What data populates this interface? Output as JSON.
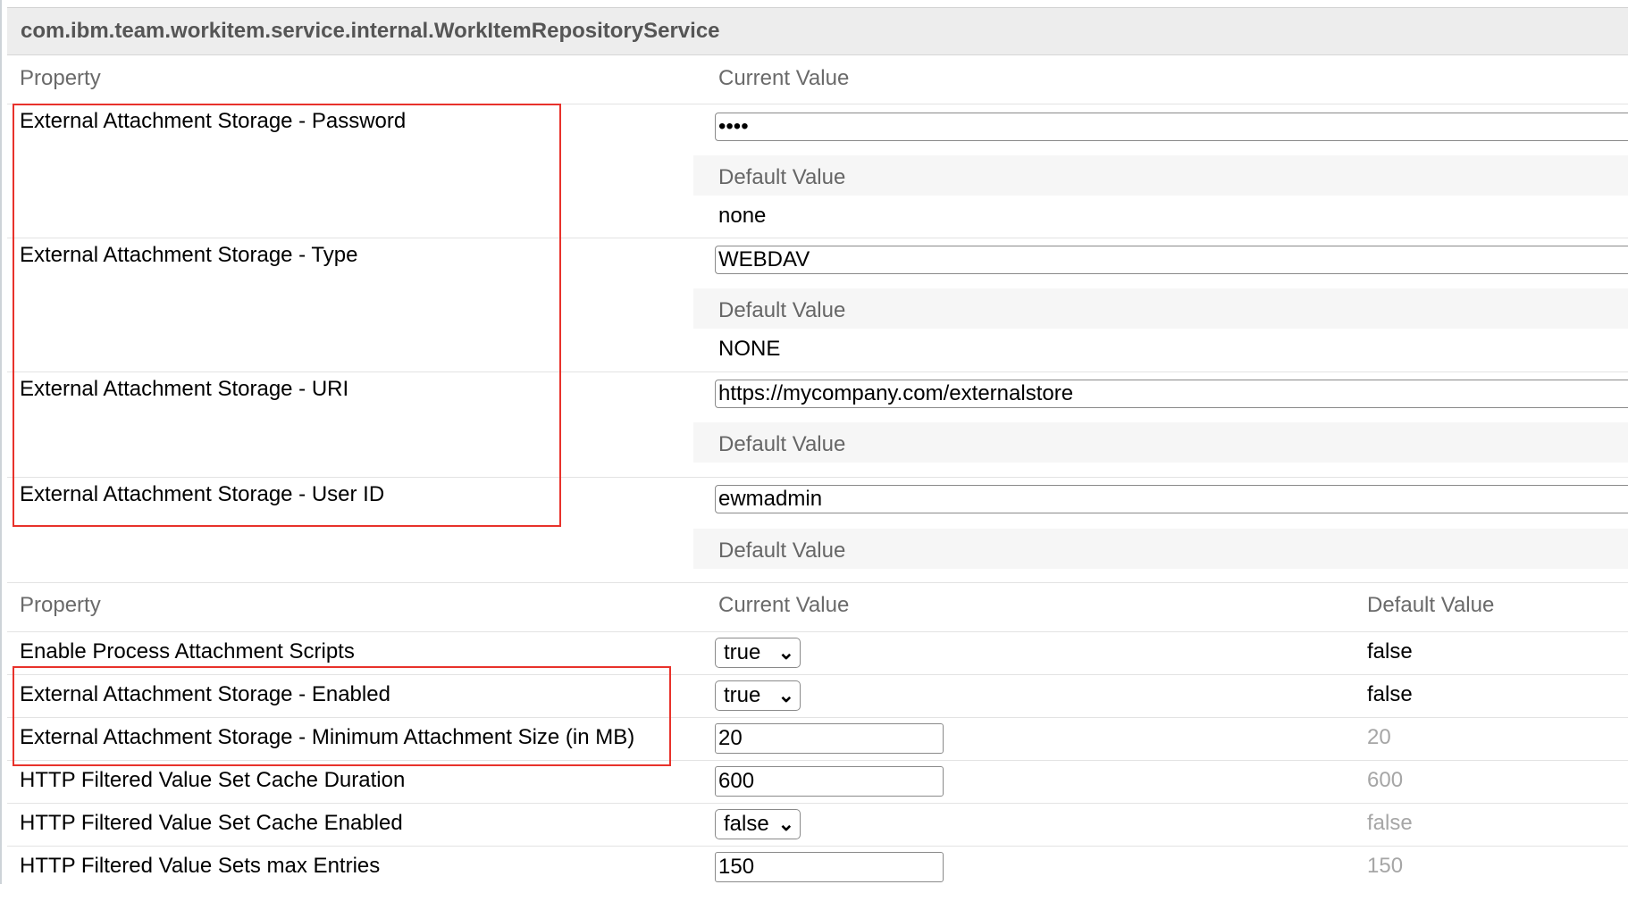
{
  "service": {
    "title": "com.ibm.team.workitem.service.internal.WorkItemRepositoryService"
  },
  "section1": {
    "columns": {
      "property": "Property",
      "current_value": "Current Value"
    },
    "default_label": "Default Value",
    "rows": [
      {
        "property": "External Attachment Storage - Password",
        "current": "••••",
        "default": "none"
      },
      {
        "property": "External Attachment Storage - Type",
        "current": "WEBDAV",
        "default": "NONE"
      },
      {
        "property": "External Attachment Storage - URI",
        "current": "https://mycompany.com/externalstore",
        "default": ""
      },
      {
        "property": "External Attachment Storage - User ID",
        "current": "ewmadmin",
        "default": ""
      }
    ]
  },
  "section2": {
    "columns": {
      "property": "Property",
      "current_value": "Current Value",
      "default_value": "Default Value"
    },
    "rows": [
      {
        "property": "Enable Process Attachment Scripts",
        "current": "true",
        "control": "select",
        "default": "false"
      },
      {
        "property": "External Attachment Storage - Enabled",
        "current": "true",
        "control": "select",
        "default": "false"
      },
      {
        "property": "External Attachment Storage - Minimum Attachment Size (in MB)",
        "current": "20",
        "control": "input",
        "default": "20"
      },
      {
        "property": "HTTP Filtered Value Set Cache Duration",
        "current": "600",
        "control": "input",
        "default": "600"
      },
      {
        "property": "HTTP Filtered Value Set Cache Enabled",
        "current": "false",
        "control": "select",
        "default": "false"
      },
      {
        "property": "HTTP Filtered Value Sets max Entries",
        "current": "150",
        "control": "input",
        "default": "150"
      }
    ]
  },
  "colors": {
    "highlight": "#e8322b",
    "header_bg": "#ededed",
    "band_bg": "#f6f6f6",
    "muted_default": "#a6a6a6"
  },
  "icons": {
    "select_arrow": "chevron-down-icon"
  }
}
